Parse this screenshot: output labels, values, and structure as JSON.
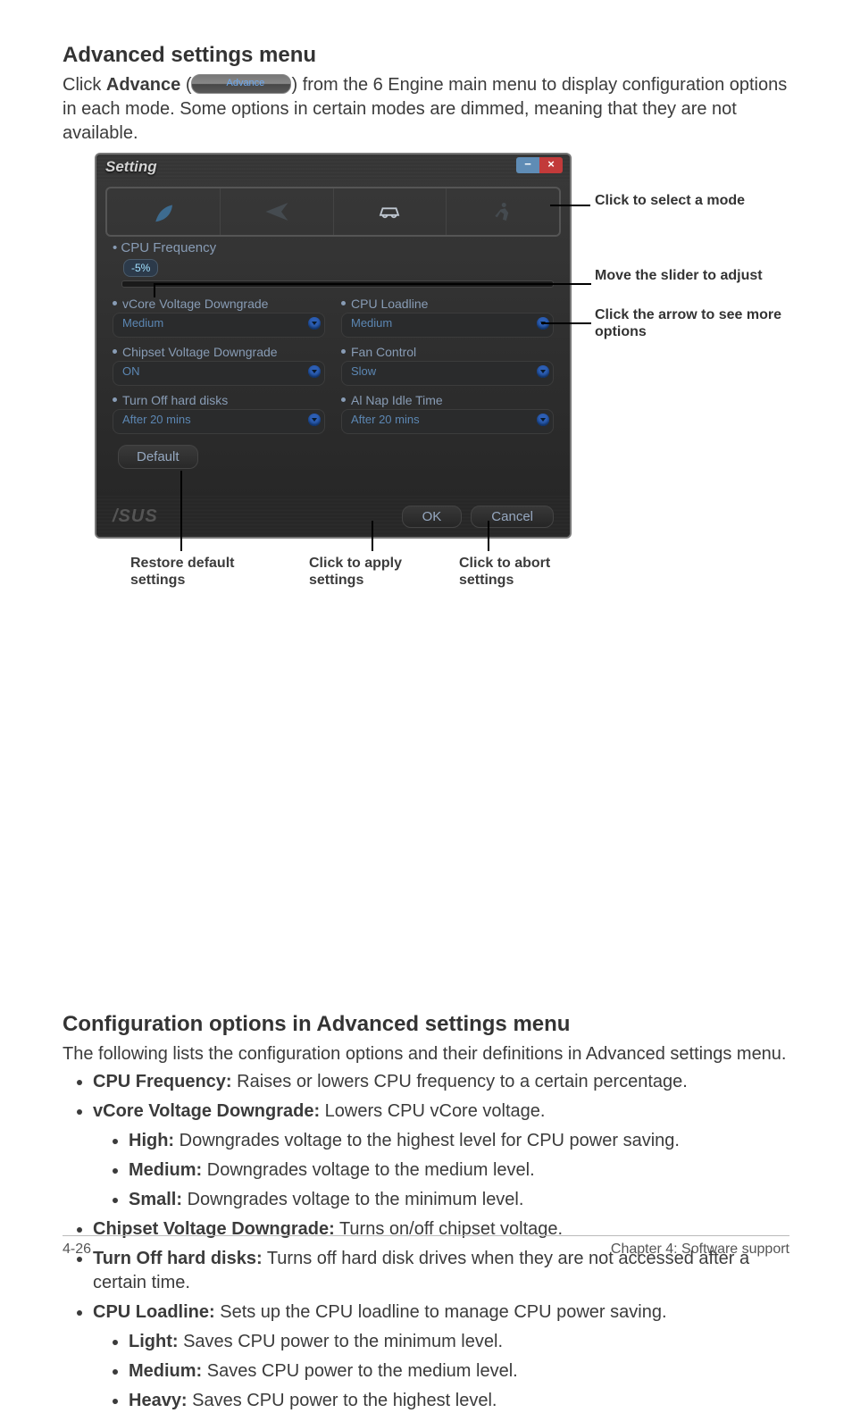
{
  "heading1": "Advanced settings menu",
  "intro": {
    "part1": "Click ",
    "advance_word": "Advance",
    "chip_label": "Advance",
    "part2": ") from the 6 Engine main menu to display configuration options in each mode. Some options in certain modes are dimmed, meaning that they are not available."
  },
  "dialog": {
    "title": "Setting",
    "min_btn": "−",
    "close_btn": "×",
    "cpu_freq_label": "CPU Frequency",
    "slider_value": "-5%",
    "left": {
      "vcore": {
        "label": "vCore Voltage Downgrade",
        "value": "Medium"
      },
      "chipset": {
        "label": "Chipset Voltage Downgrade",
        "value": "ON"
      },
      "turnoff": {
        "label": "Turn Off hard disks",
        "value": "After 20 mins"
      }
    },
    "right": {
      "loadline": {
        "label": "CPU Loadline",
        "value": "Medium"
      },
      "fan": {
        "label": "Fan Control",
        "value": "Slow"
      },
      "alnap": {
        "label": "Al Nap Idle Time",
        "value": "After 20 mins"
      }
    },
    "default_btn": "Default",
    "ok_btn": "OK",
    "cancel_btn": "Cancel"
  },
  "callouts": {
    "select_mode": "Click to select a mode",
    "move_slider": "Move the slider to adjust",
    "click_arrow": "Click the arrow to see more options"
  },
  "captions": {
    "restore": "Restore default settings",
    "apply": "Click to apply settings",
    "abort": "Click to abort settings"
  },
  "heading2": "Configuration options in Advanced settings menu",
  "intro2": "The following lists the configuration options and their definitions in Advanced settings menu.",
  "bullets": {
    "cpu_freq": {
      "bold": "CPU Frequency:",
      "rest": " Raises or lowers CPU frequency to a certain percentage."
    },
    "vcore": {
      "bold": "vCore Voltage Downgrade:",
      "rest": " Lowers CPU vCore voltage.",
      "sub": [
        {
          "bold": "High:",
          "rest": " Downgrades voltage to the highest level for CPU power saving."
        },
        {
          "bold": "Medium:",
          "rest": " Downgrades voltage to the medium level."
        },
        {
          "bold": "Small:",
          "rest": " Downgrades voltage to the minimum level."
        }
      ]
    },
    "chipset": {
      "bold": "Chipset Voltage Downgrade:",
      "rest": " Turns on/off chipset voltage."
    },
    "turnoff": {
      "bold": "Turn Off hard disks:",
      "rest": " Turns off hard disk drives when they are not accessed after a certain time."
    },
    "loadline": {
      "bold": "CPU Loadline:",
      "rest": " Sets up the CPU loadline to manage CPU power saving.",
      "sub": [
        {
          "bold": "Light:",
          "rest": " Saves CPU power to the minimum level."
        },
        {
          "bold": "Medium:",
          "rest": " Saves CPU power to the medium level."
        },
        {
          "bold": "Heavy:",
          "rest": " Saves CPU power to the highest level."
        }
      ]
    }
  },
  "footer": {
    "left": "4-26",
    "right": "Chapter 4: Software support"
  }
}
